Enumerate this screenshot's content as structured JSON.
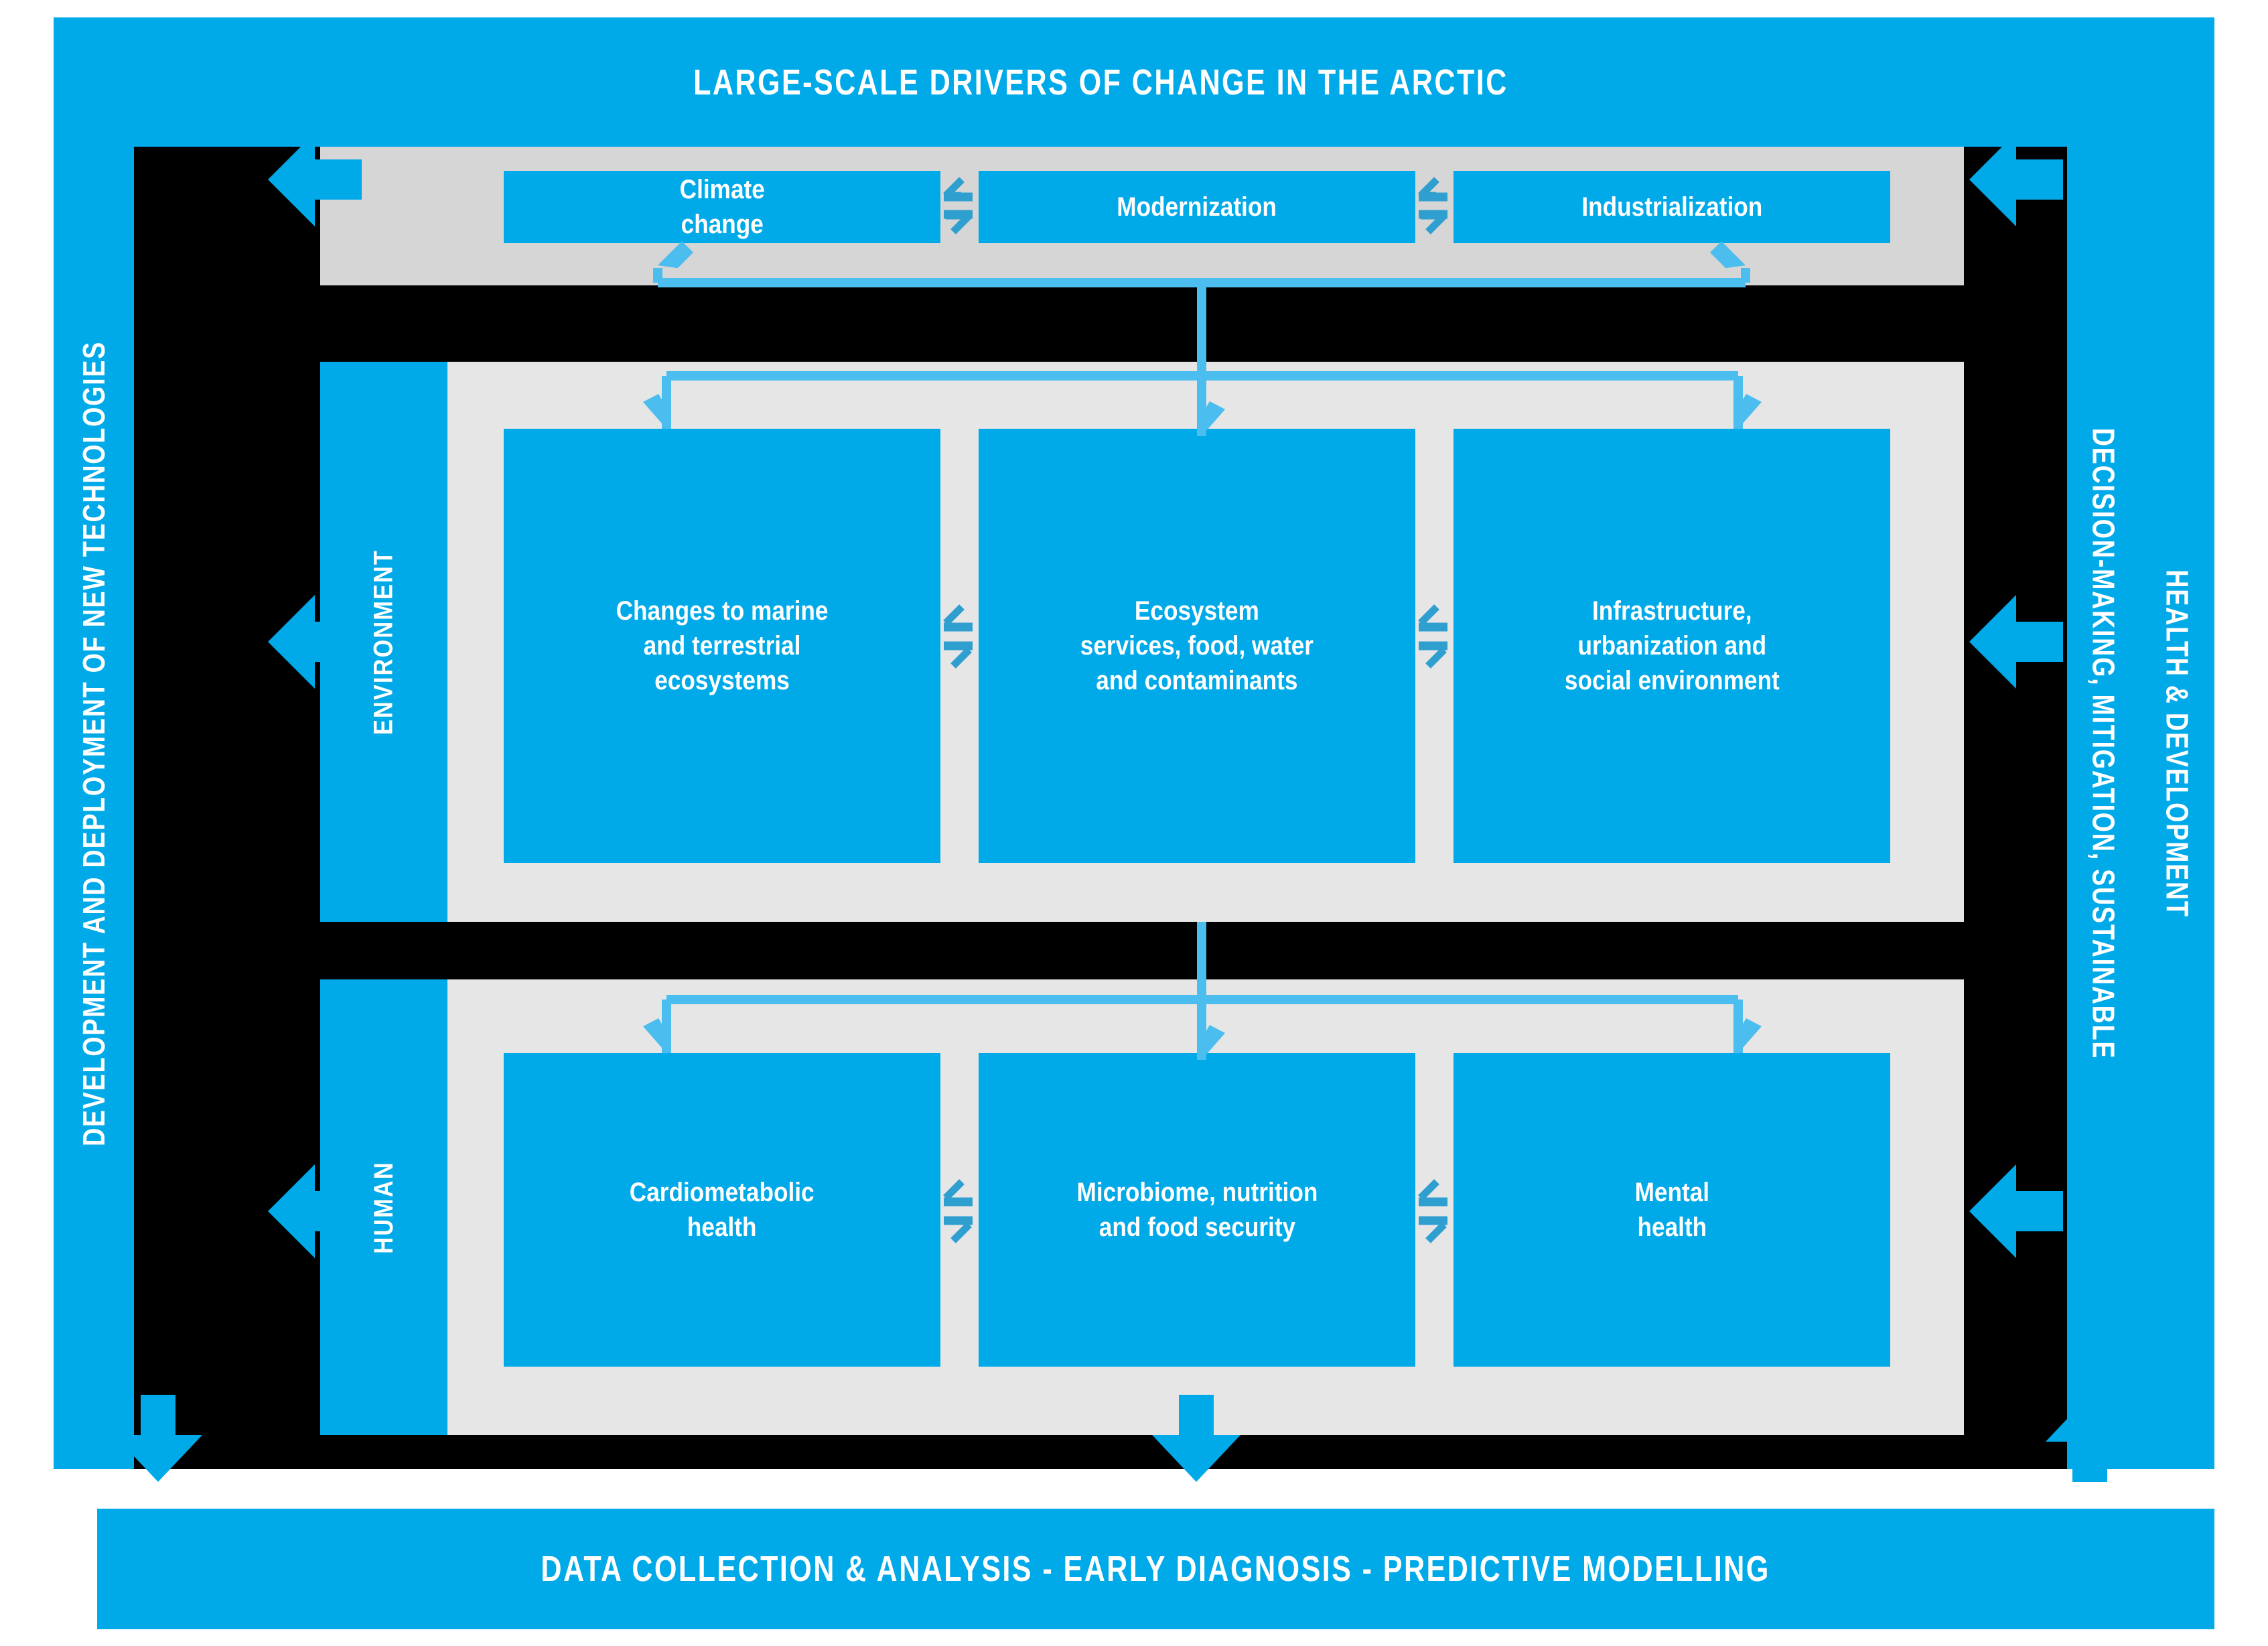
{
  "header": {
    "title": "LARGE-SCALE DRIVERS OF CHANGE IN THE ARCTIC"
  },
  "footer": {
    "title": "DATA COLLECTION & ANALYSIS - EARLY DIAGNOSIS - PREDICTIVE MODELLING"
  },
  "left_rail": {
    "label": "DEVELOPMENT AND DEPLOYMENT OF NEW TECHNOLOGIES"
  },
  "right_rail": {
    "line1": "DECISION-MAKING, MITIGATION, SUSTAINABLE",
    "line2": "HEALTH & DEVELOPMENT"
  },
  "rows": [
    {
      "id": "drivers",
      "row_label": "",
      "nodes": [
        {
          "label": "Climate\nchange"
        },
        {
          "label": "Modernization"
        },
        {
          "label": "Industrialization"
        }
      ]
    },
    {
      "id": "environment",
      "row_label": "ENVIRONMENT",
      "nodes": [
        {
          "label": "Changes to marine\nand terrestrial\necosystems"
        },
        {
          "label": "Ecosystem\nservices, food, water\nand contaminants"
        },
        {
          "label": "Infrastructure,\nurbanization and\nsocial environment"
        }
      ]
    },
    {
      "id": "human",
      "row_label": "HUMAN",
      "nodes": [
        {
          "label": "Cardiometabolic\nhealth"
        },
        {
          "label": "Microbiome, nutrition\nand food security"
        },
        {
          "label": "Mental\nhealth"
        }
      ]
    }
  ],
  "colors": {
    "accent_blue": "#00A9E8",
    "arrow_blue": "#4BBDEE",
    "connector_blue": "#2F9FD0",
    "frame_black": "#000000",
    "panel_gray_dark": "#D6D6D6",
    "panel_gray_light": "#E6E6E6",
    "text_white": "#FFFFFF"
  },
  "icons": {
    "left_arrow": "arrow-left-icon",
    "down_arrow": "arrow-down-icon",
    "up_arrow": "arrow-up-icon",
    "bidirectional": "bidirectional-arrow-icon"
  }
}
